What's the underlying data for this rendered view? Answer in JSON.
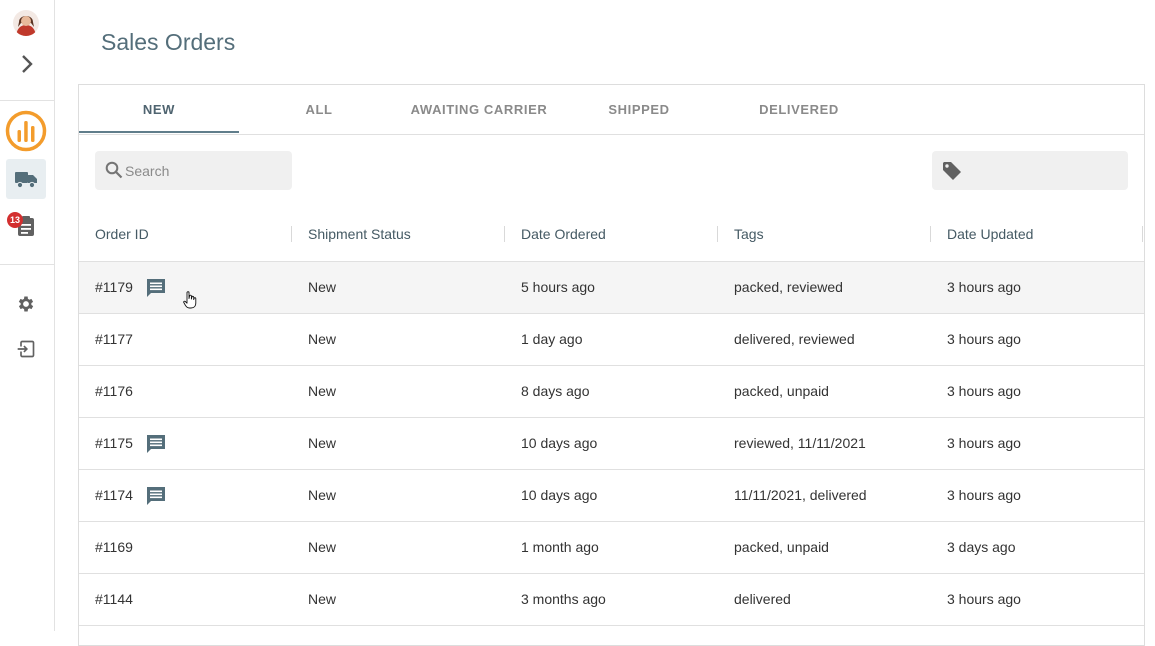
{
  "page": {
    "title": "Sales Orders"
  },
  "sidebar": {
    "badge_count": "13",
    "accent_color": "#f39c2c"
  },
  "tabs": [
    {
      "label": "NEW",
      "active": true
    },
    {
      "label": "ALL"
    },
    {
      "label": "AWAITING CARRIER"
    },
    {
      "label": "SHIPPED"
    },
    {
      "label": "DELIVERED"
    }
  ],
  "search": {
    "placeholder": "Search"
  },
  "table": {
    "columns": [
      "Order ID",
      "Shipment Status",
      "Date Ordered",
      "Tags",
      "Date Updated"
    ],
    "rows": [
      {
        "id": "#1179",
        "status": "New",
        "ordered": "5 hours ago",
        "tags": "packed, reviewed",
        "updated": "3 hours ago",
        "comment": true
      },
      {
        "id": "#1177",
        "status": "New",
        "ordered": "1 day ago",
        "tags": "delivered, reviewed",
        "updated": "3 hours ago",
        "comment": false
      },
      {
        "id": "#1176",
        "status": "New",
        "ordered": "8 days ago",
        "tags": "packed, unpaid",
        "updated": "3 hours ago",
        "comment": false
      },
      {
        "id": "#1175",
        "status": "New",
        "ordered": "10 days ago",
        "tags": "reviewed, 11/11/2021",
        "updated": "3 hours ago",
        "comment": true
      },
      {
        "id": "#1174",
        "status": "New",
        "ordered": "10 days ago",
        "tags": "11/11/2021, delivered",
        "updated": "3 hours ago",
        "comment": true
      },
      {
        "id": "#1169",
        "status": "New",
        "ordered": "1 month ago",
        "tags": "packed, unpaid",
        "updated": "3 days ago",
        "comment": false
      },
      {
        "id": "#1144",
        "status": "New",
        "ordered": "3 months ago",
        "tags": "delivered",
        "updated": "3 hours ago",
        "comment": false
      }
    ]
  }
}
